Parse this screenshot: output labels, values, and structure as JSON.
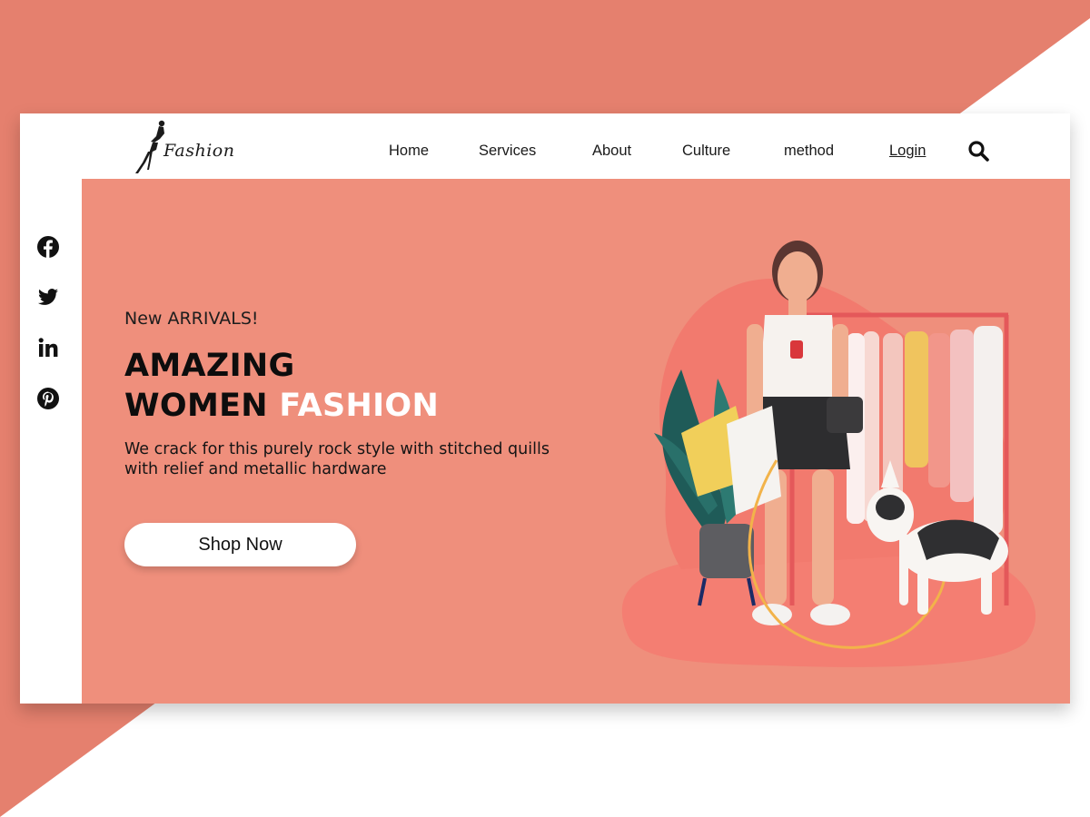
{
  "brand": {
    "logo_text": "Fashion"
  },
  "nav": {
    "items": [
      "Home",
      "Services",
      "About",
      "Culture",
      "method"
    ],
    "login": "Login"
  },
  "icons": {
    "search": "search-icon",
    "social": [
      "facebook-icon",
      "twitter-icon",
      "linkedin-icon",
      "pinterest-icon"
    ]
  },
  "hero": {
    "eyebrow": "New ARRIVALS!",
    "headline_line1": "AMAZING",
    "headline_line2_dark": "WOMEN",
    "headline_line2_light": "FASHION",
    "description": "We crack for this purely rock style with stitched quills with relief and metallic hardware",
    "cta": "Shop Now"
  },
  "colors": {
    "background_band": "#e5806e",
    "hero_background": "#ef8f7c",
    "card": "#ffffff",
    "accent_text": "#ffffff",
    "text_dark": "#0d0d0d"
  }
}
